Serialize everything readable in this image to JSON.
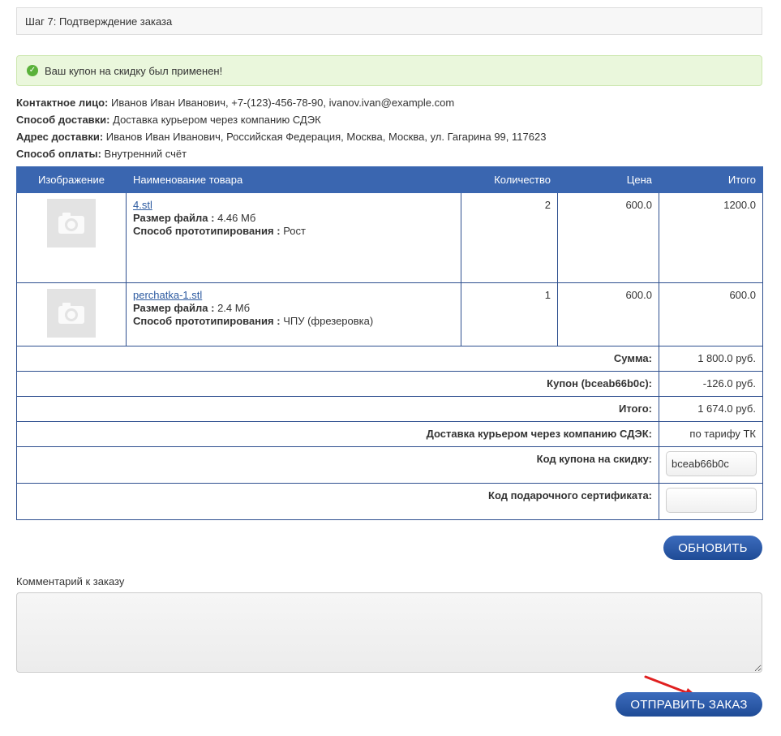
{
  "step": {
    "title": "Шаг 7: Подтверждение заказа"
  },
  "alert": {
    "text": "Ваш купон на скидку был применен!"
  },
  "info": {
    "contact_label": "Контактное лицо:",
    "contact_value": "Иванов Иван Иванович, +7-(123)-456-78-90, ivanov.ivan@example.com",
    "delivery_label": "Способ доставки:",
    "delivery_value": "Доставка курьером через компанию СДЭК",
    "address_label": "Адрес доставки:",
    "address_value": "Иванов Иван Иванович, Российская Федерация, Москва, Москва, ул. Гагарина 99, 117623",
    "payment_label": "Способ оплаты:",
    "payment_value": "Внутренний счёт"
  },
  "table": {
    "headers": {
      "image": "Изображение",
      "name": "Наименование товара",
      "qty": "Количество",
      "price": "Цена",
      "total": "Итого"
    },
    "items": [
      {
        "name": "4.stl",
        "size_label": "Размер файла :",
        "size_value": "4.46 Мб",
        "method_label": "Способ прототипирования :",
        "method_value": "Рост",
        "qty": "2",
        "price": "600.0",
        "total": "1200.0"
      },
      {
        "name": "perchatka-1.stl",
        "size_label": "Размер файла :",
        "size_value": "2.4 Мб",
        "method_label": "Способ прототипирования :",
        "method_value": "ЧПУ (фрезеровка)",
        "qty": "1",
        "price": "600.0",
        "total": "600.0"
      }
    ],
    "totals": {
      "sum_label": "Сумма:",
      "sum_value": "1 800.0 руб.",
      "coupon_label": "Купон (bceab66b0c):",
      "coupon_value": "-126.0 руб.",
      "grand_label": "Итого:",
      "grand_value": "1 674.0 руб.",
      "shipping_label": "Доставка курьером через компанию СДЭК:",
      "shipping_value": "по тарифу ТК",
      "coupon_code_label": "Код купона на скидку:",
      "coupon_code_value": "bceab66b0c",
      "gift_label": "Код подарочного сертификата:",
      "gift_value": ""
    }
  },
  "buttons": {
    "update": "ОБНОВИТЬ",
    "submit": "ОТПРАВИТЬ ЗАКАЗ"
  },
  "comment": {
    "label": "Комментарий к заказу",
    "value": ""
  },
  "colors": {
    "header_blue": "#3a66b0",
    "button_blue": "#1f4b96",
    "alert_green": "#eaf7dc",
    "arrow_red": "#e02020"
  }
}
